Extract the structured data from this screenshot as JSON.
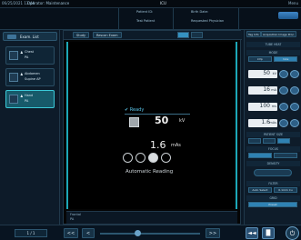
{
  "topbar": {
    "datetime": "06/25/2021 13:44",
    "operator": "Operator: Maintenance",
    "center_status": "ICU",
    "right_status": "",
    "right_menu": "Menu"
  },
  "patient": {
    "patient_id_label": "Patient ID:",
    "accession_label": "Accession No.",
    "birth_label": "Birth Date:",
    "sex_label": "Sex:",
    "operator_label": "Operator:",
    "patient_id": "0000000001",
    "name": "Test Patient",
    "birth_date": "1990/01/01",
    "sex": "M",
    "ref_physician": "Requested Physician"
  },
  "left_panel": {
    "tab_label": "Exam. List",
    "steps": [
      {
        "line1": "Chest",
        "line2": "PA",
        "active": false
      },
      {
        "line1": "Abdomen",
        "line2": "Supine AP",
        "active": false
      },
      {
        "line1": "Hand",
        "line2": "PA",
        "active": true
      }
    ]
  },
  "viewer": {
    "tabs": [
      "Study",
      "Rescan Exam"
    ],
    "status": "Ready",
    "kv_value": "50",
    "kv_unit": "kV",
    "mas_value": "1.6",
    "mas_unit": "mAs",
    "reading_mode": "Automatic Reading",
    "footer_line1": "Frontal",
    "footer_line2": "PA"
  },
  "right_panel": {
    "tabs": [
      "Tag Info",
      "Acquisition Image Proc."
    ],
    "tube_label": "TUBE HEAT",
    "mode_label": "MODE",
    "mode_options": [
      "kVp",
      "mAs"
    ],
    "params": [
      {
        "value": "50",
        "unit": "kV"
      },
      {
        "value": "16",
        "unit": "mA"
      },
      {
        "value": "100",
        "unit": "ms"
      },
      {
        "value": "1.6",
        "unit": "mAs"
      }
    ],
    "patient_size_label": "PATIENT SIZE",
    "focus_label": "FOCUS",
    "density_label": "DENSITY",
    "filter_label": "FILTER",
    "grid_label": "GRID",
    "preset_labels": [
      "Auto Select",
      "0.1mm Cu",
      "Preset"
    ]
  },
  "bottombar": {
    "page": "1 / 1",
    "buttons": [
      "<<",
      "<"
    ],
    "next_button": ">>",
    "right_buttons": [
      "◄◄",
      "▐▌"
    ],
    "power": "⏻"
  }
}
